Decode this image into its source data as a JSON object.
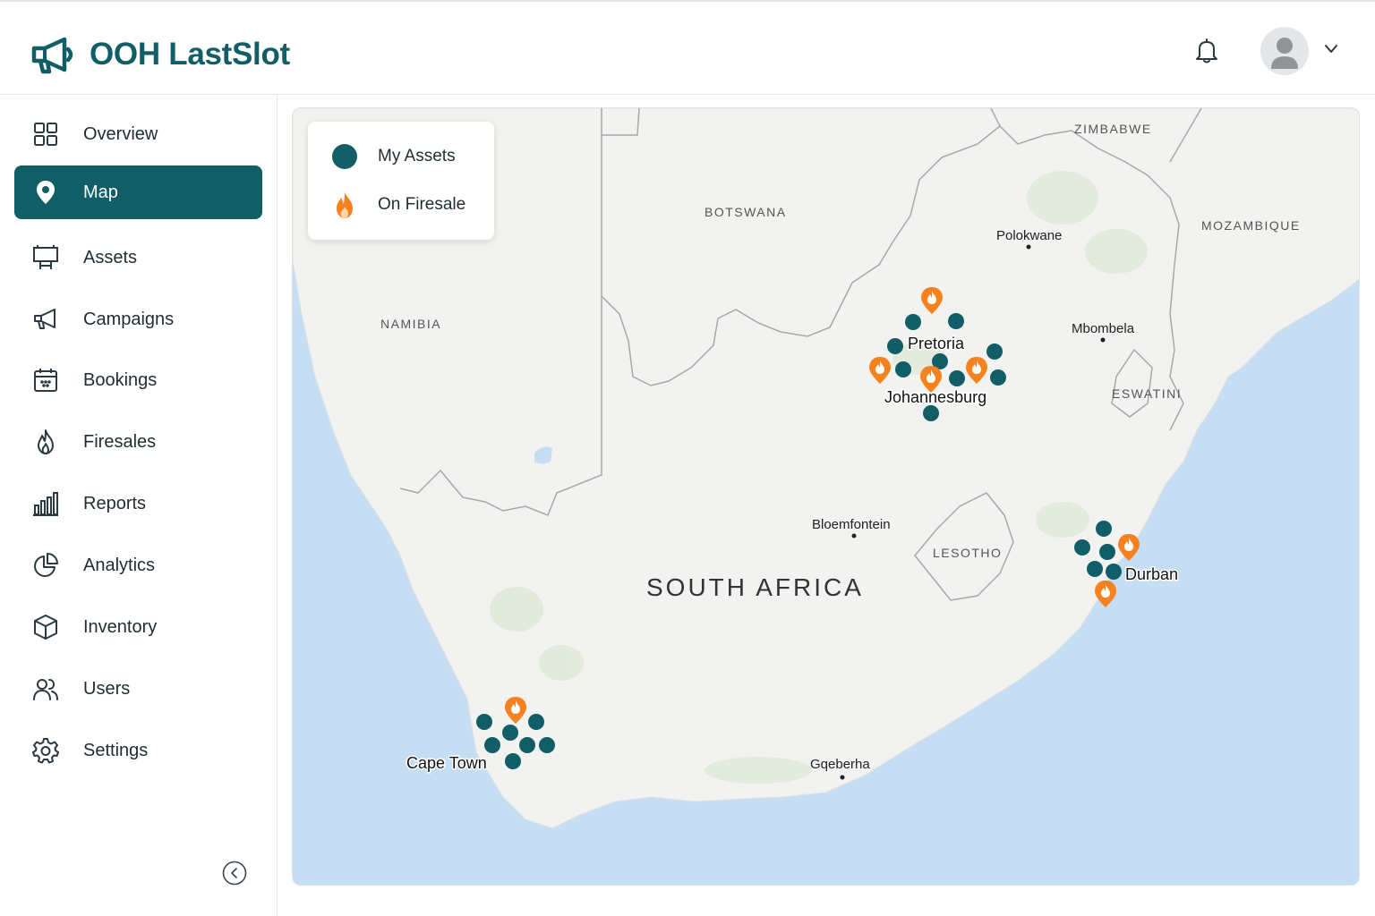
{
  "app": {
    "title": "OOH LastSlot"
  },
  "header": {
    "notifications_icon": "bell-icon",
    "avatar_icon": "user-avatar",
    "menu_icon": "chevron-down-icon"
  },
  "colors": {
    "brand": "#115e67",
    "firesale": "#f5821f",
    "water": "#c5def3",
    "land": "#f2f2f2"
  },
  "sidebar": {
    "items": [
      {
        "label": "Overview",
        "icon": "grid-icon",
        "active": false
      },
      {
        "label": "Map",
        "icon": "map-pin-icon",
        "active": true
      },
      {
        "label": "Assets",
        "icon": "billboard-icon",
        "active": false
      },
      {
        "label": "Campaigns",
        "icon": "megaphone-icon",
        "active": false
      },
      {
        "label": "Bookings",
        "icon": "calendar-icon",
        "active": false
      },
      {
        "label": "Firesales",
        "icon": "flame-icon",
        "active": false
      },
      {
        "label": "Reports",
        "icon": "bar-chart-icon",
        "active": false
      },
      {
        "label": "Analytics",
        "icon": "pie-chart-icon",
        "active": false
      },
      {
        "label": "Inventory",
        "icon": "box-icon",
        "active": false
      },
      {
        "label": "Users",
        "icon": "users-icon",
        "active": false
      },
      {
        "label": "Settings",
        "icon": "gear-icon",
        "active": false
      }
    ],
    "collapse_icon": "collapse-left-icon"
  },
  "legend": {
    "my_assets": "My Assets",
    "on_firesale": "On Firesale"
  },
  "map": {
    "countries": {
      "zimbabwe": "ZIMBABWE",
      "botswana": "BOTSWANA",
      "mozambique": "MOZAMBIQUE",
      "namibia": "NAMIBIA",
      "eswatini": "ESWATINI",
      "lesotho": "LESOTHO",
      "south_africa": "SOUTH AFRICA"
    },
    "cities": {
      "polokwane": "Polokwane",
      "mbombela": "Mbombela",
      "pretoria": "Pretoria",
      "johannesburg": "Johannesburg",
      "bloemfontein": "Bloemfontein",
      "durban": "Durban",
      "cape_town": "Cape Town",
      "gqeberha": "Gqeberha"
    }
  }
}
